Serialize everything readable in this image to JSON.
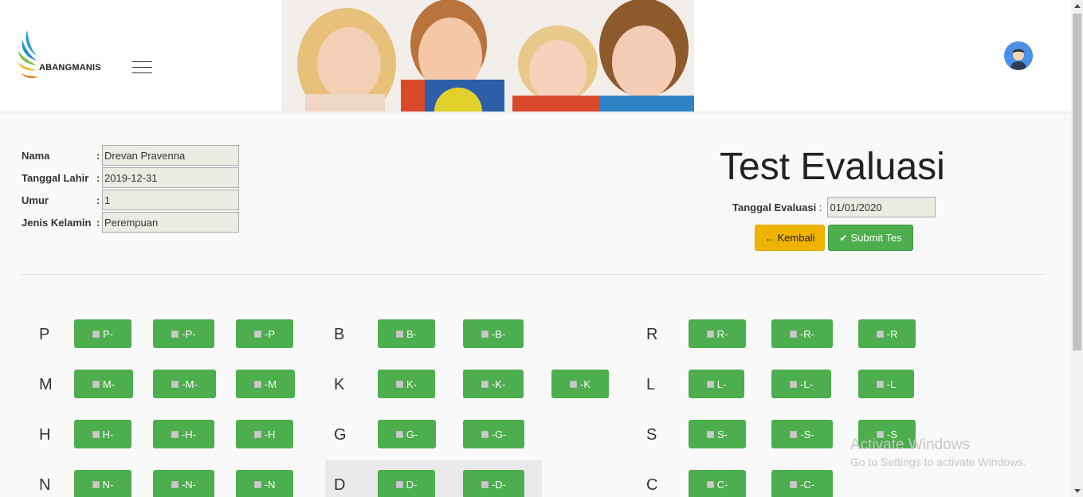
{
  "brand": {
    "name": "ABANGMANIS"
  },
  "form": {
    "nama_label": "Nama",
    "nama_value": "Drevan Pravenna",
    "tgl_label": "Tanggal Lahir",
    "tgl_value": "2019-12-31",
    "umur_label": "Umur",
    "umur_value": "1",
    "jk_label": "Jenis Kelamin",
    "jk_value": "Perempuan",
    "colon": ":"
  },
  "evaluation": {
    "title": "Test Evaluasi",
    "date_label": "Tanggal Evaluasi",
    "date_colon": ":",
    "date_value": "01/01/2020",
    "back_label": "Kembali",
    "submit_label": "Submit Tes"
  },
  "letters": {
    "P": "P",
    "M": "M",
    "H": "H",
    "N": "N",
    "B": "B",
    "K": "K",
    "G": "G",
    "D": "D",
    "R": "R",
    "L": "L",
    "S": "S",
    "C": "C"
  },
  "sounds": {
    "p1": "P-",
    "p2": "-P-",
    "p3": "-P",
    "m1": "M-",
    "m2": "-M-",
    "m3": "-M",
    "h1": "H-",
    "h2": "-H-",
    "h3": "-H",
    "n1": "N-",
    "n2": "-N-",
    "n3": "-N",
    "b1": "B-",
    "b2": "-B-",
    "k1": "K-",
    "k2": "-K-",
    "k3": "-K",
    "g1": "G-",
    "g2": "-G-",
    "d1": "D-",
    "d2": "-D-",
    "r1": "R-",
    "r2": "-R-",
    "r3": "-R",
    "l1": "L-",
    "l2": "-L-",
    "l3": "-L",
    "s1": "S-",
    "s2": "-S-",
    "s3": "-S",
    "c1": "C-",
    "c2": "-C-"
  },
  "watermark": {
    "line1": "Activate Windows",
    "line2": "Go to Settings to activate Windows."
  },
  "icons": {
    "back": "arrow-left-icon",
    "submit": "check-icon",
    "menu": "hamburger-icon"
  },
  "colors": {
    "success": "#4cae4c",
    "warning": "#f0b400",
    "avatar": "#4d8fe6"
  }
}
